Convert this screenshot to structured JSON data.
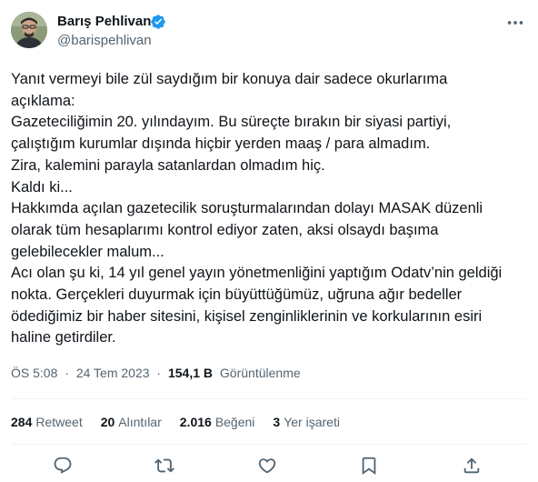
{
  "author": {
    "display_name": "Barış Pehlivan",
    "handle": "@barispehlivan",
    "verified": true
  },
  "tweet": {
    "lines": [
      "Yanıt vermeyi bile zül saydığım bir konuya dair sadece okurlarıma",
      "açıklama:",
      "Gazeteciliğimin 20. yılındayım. Bu süreçte bırakın bir siyasi partiyi,",
      "çalıştığım kurumlar dışında hiçbir yerden maaş / para almadım.",
      "Zira, kalemini parayla satanlardan olmadım hiç.",
      "Kaldı ki...",
      "Hakkımda açılan gazetecilik soruşturmalarından dolayı MASAK düzenli",
      "olarak tüm hesaplarımı kontrol ediyor zaten, aksi olsaydı başıma",
      "gelebilecekler malum...",
      "Acı olan şu ki, 14 yıl genel yayın yönetmenliğini yaptığım Odatv’nin geldiği",
      "nokta. Gerçekleri duyurmak için büyüttüğümüz, uğruna ağır bedeller",
      "ödediğimiz bir haber sitesini, kişisel zenginliklerinin ve korkularının esiri",
      "haline getirdiler."
    ]
  },
  "meta": {
    "time": "ÖS 5:08",
    "separator": "·",
    "date": "24 Tem 2023",
    "views_count": "154,1 B",
    "views_label": "Görüntülenme"
  },
  "stats": {
    "retweets": {
      "count": "284",
      "label": "Retweet"
    },
    "quotes": {
      "count": "20",
      "label": "Alıntılar"
    },
    "likes": {
      "count": "2.016",
      "label": "Beğeni"
    },
    "bookmarks": {
      "count": "3",
      "label": "Yer işareti"
    }
  },
  "icons": {
    "verified": "verified-badge-icon",
    "more": "more-icon",
    "reply": "reply-icon",
    "retweet": "retweet-icon",
    "like": "like-icon",
    "bookmark": "bookmark-icon",
    "share": "share-icon"
  },
  "colors": {
    "verified": "#1d9bf0",
    "text": "#0f1419",
    "secondary": "#536471",
    "divider": "#eff3f4"
  }
}
